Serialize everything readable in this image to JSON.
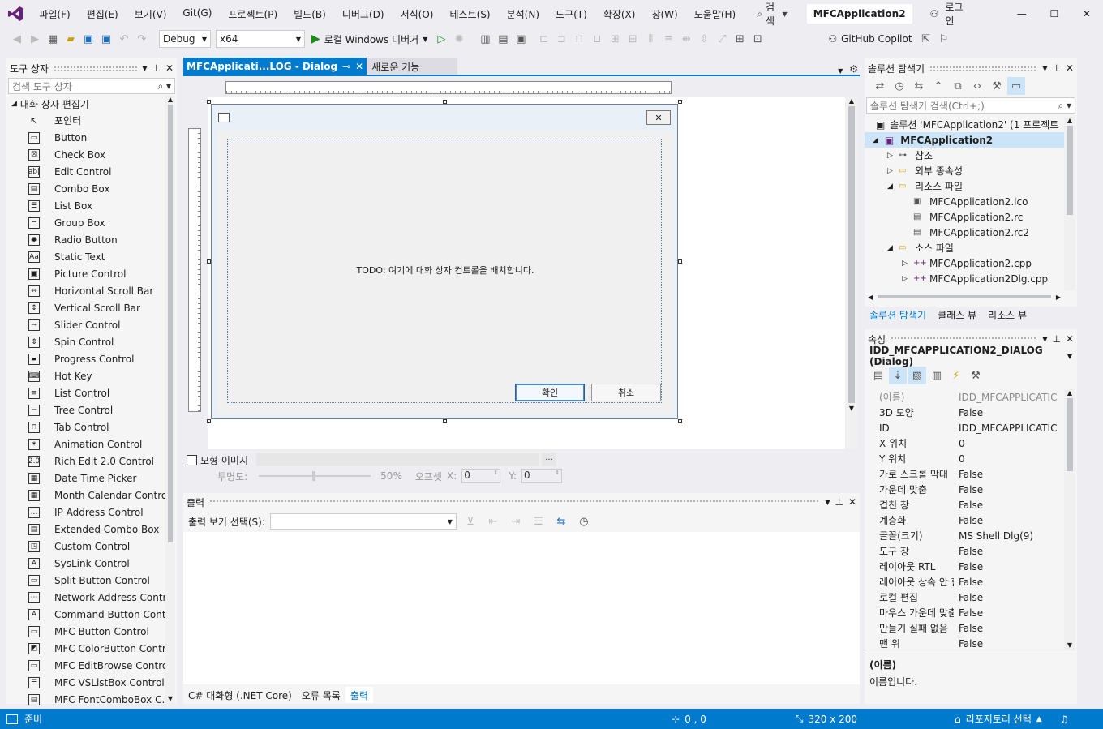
{
  "menu": {
    "items": [
      "파일(F)",
      "편집(E)",
      "보기(V)",
      "Git(G)",
      "프로젝트(P)",
      "빌드(B)",
      "디버그(D)",
      "서식(O)",
      "테스트(S)",
      "분석(N)",
      "도구(T)",
      "확장(X)",
      "창(W)",
      "도움말(H)"
    ],
    "search_label": "검색",
    "solution_name": "MFCApplication2",
    "login_label": "로그인"
  },
  "toolbar": {
    "config": "Debug",
    "platform": "x64",
    "debugger": "로컬 Windows 디버거",
    "copilot": "GitHub Copilot"
  },
  "toolbox": {
    "title": "도구 상자",
    "search_placeholder": "검색 도구 상자",
    "group": "대화 상자 편집기",
    "items": [
      {
        "label": "포인터",
        "icon": "pointer-icon",
        "glyph": "↖"
      },
      {
        "label": "Button",
        "icon": "button-icon",
        "glyph": "▭"
      },
      {
        "label": "Check Box",
        "icon": "checkbox-icon",
        "glyph": "☒"
      },
      {
        "label": "Edit Control",
        "icon": "edit-control-icon",
        "glyph": "ab|"
      },
      {
        "label": "Combo Box",
        "icon": "combo-box-icon",
        "glyph": "▤"
      },
      {
        "label": "List Box",
        "icon": "list-box-icon",
        "glyph": "☰"
      },
      {
        "label": "Group Box",
        "icon": "group-box-icon",
        "glyph": "⌐"
      },
      {
        "label": "Radio Button",
        "icon": "radio-button-icon",
        "glyph": "◉"
      },
      {
        "label": "Static Text",
        "icon": "static-text-icon",
        "glyph": "Aa"
      },
      {
        "label": "Picture Control",
        "icon": "picture-control-icon",
        "glyph": "▣"
      },
      {
        "label": "Horizontal Scroll Bar",
        "icon": "hscroll-icon",
        "glyph": "↔"
      },
      {
        "label": "Vertical Scroll Bar",
        "icon": "vscroll-icon",
        "glyph": "↕"
      },
      {
        "label": "Slider Control",
        "icon": "slider-icon",
        "glyph": "⊸"
      },
      {
        "label": "Spin Control",
        "icon": "spin-icon",
        "glyph": "⇕"
      },
      {
        "label": "Progress Control",
        "icon": "progress-icon",
        "glyph": "▰"
      },
      {
        "label": "Hot Key",
        "icon": "hot-key-icon",
        "glyph": "⌨"
      },
      {
        "label": "List Control",
        "icon": "list-control-icon",
        "glyph": "≡"
      },
      {
        "label": "Tree Control",
        "icon": "tree-control-icon",
        "glyph": "⊢"
      },
      {
        "label": "Tab Control",
        "icon": "tab-control-icon",
        "glyph": "⊓"
      },
      {
        "label": "Animation Control",
        "icon": "animation-icon",
        "glyph": "✶"
      },
      {
        "label": "Rich Edit 2.0 Control",
        "icon": "rich-edit-icon",
        "glyph": "2.0"
      },
      {
        "label": "Date Time Picker",
        "icon": "date-time-icon",
        "glyph": "▦"
      },
      {
        "label": "Month Calendar Control",
        "icon": "calendar-icon",
        "glyph": "▦"
      },
      {
        "label": "IP Address Control",
        "icon": "ip-address-icon",
        "glyph": "…"
      },
      {
        "label": "Extended Combo Box",
        "icon": "ext-combo-icon",
        "glyph": "▤"
      },
      {
        "label": "Custom Control",
        "icon": "custom-control-icon",
        "glyph": "◳"
      },
      {
        "label": "SysLink Control",
        "icon": "syslink-icon",
        "glyph": "A"
      },
      {
        "label": "Split Button Control",
        "icon": "split-button-icon",
        "glyph": "▭"
      },
      {
        "label": "Network Address Control",
        "icon": "network-icon",
        "glyph": "⋯"
      },
      {
        "label": "Command Button Cont...",
        "icon": "command-button-icon",
        "glyph": "A"
      },
      {
        "label": "MFC Button Control",
        "icon": "mfc-button-icon",
        "glyph": "▭"
      },
      {
        "label": "MFC ColorButton Control",
        "icon": "color-button-icon",
        "glyph": "◩"
      },
      {
        "label": "MFC EditBrowse Control",
        "icon": "edit-browse-icon",
        "glyph": "▭"
      },
      {
        "label": "MFC VSListBox Control",
        "icon": "vslistbox-icon",
        "glyph": "☰"
      },
      {
        "label": "MFC FontComboBox C...",
        "icon": "font-combo-icon",
        "glyph": "▤"
      }
    ]
  },
  "editor": {
    "tab_active": "MFCApplicati...LOG - Dialog",
    "tab_inactive": "새로운 기능",
    "dialog_todo": "TODO: 여기에 대화 상자 컨트롤을 배치합니다.",
    "ok_button": "확인",
    "cancel_button": "취소",
    "mock_image_label": "모형 이미지",
    "opacity_label": "투명도:",
    "opacity_value": "50%",
    "offset_label": "오프셋",
    "x_label": "X:",
    "x_value": "0",
    "y_label": "Y:",
    "y_value": "0",
    "browse": "..."
  },
  "output": {
    "title": "출력",
    "select_label": "출력 보기 선택(S):",
    "tabs": [
      "C# 대화형 (.NET Core)",
      "오류 목록",
      "출력"
    ]
  },
  "solution": {
    "title": "솔루션 탐색기",
    "search_placeholder": "솔루션 탐색기 검색(Ctrl+;)",
    "root": "솔루션 'MFCApplication2' (1 프로젝트",
    "project": "MFCApplication2",
    "nodes": [
      {
        "label": "참조",
        "indent": 1,
        "arrow": "▷",
        "icon": "references-icon",
        "glyph": "⊶"
      },
      {
        "label": "외부 종속성",
        "indent": 1,
        "arrow": "▷",
        "icon": "folder-icon",
        "glyph": "▭"
      },
      {
        "label": "리소스 파일",
        "indent": 1,
        "arrow": "◢",
        "icon": "folder-open-icon",
        "glyph": "▭"
      },
      {
        "label": "MFCApplication2.ico",
        "indent": 2,
        "arrow": "",
        "icon": "image-file-icon",
        "glyph": "▣"
      },
      {
        "label": "MFCApplication2.rc",
        "indent": 2,
        "arrow": "",
        "icon": "resource-file-icon",
        "glyph": "▤"
      },
      {
        "label": "MFCApplication2.rc2",
        "indent": 2,
        "arrow": "",
        "icon": "resource-file-icon",
        "glyph": "▤"
      },
      {
        "label": "소스 파일",
        "indent": 1,
        "arrow": "◢",
        "icon": "folder-open-icon",
        "glyph": "▭"
      },
      {
        "label": "MFCApplication2.cpp",
        "indent": 2,
        "arrow": "▷",
        "icon": "cpp-file-icon",
        "glyph": "++"
      },
      {
        "label": "MFCApplication2Dlg.cpp",
        "indent": 2,
        "arrow": "▷",
        "icon": "cpp-file-icon",
        "glyph": "++"
      }
    ],
    "tabs": [
      "솔루션 탐색기",
      "클래스 뷰",
      "리소스 뷰"
    ]
  },
  "properties": {
    "title": "속성",
    "object": "IDD_MFCAPPLICATION2_DIALOG (Dialog)",
    "rows": [
      [
        "(이름)",
        "IDD_MFCAPPLICATIC"
      ],
      [
        "3D 모양",
        "False"
      ],
      [
        "ID",
        "IDD_MFCAPPLICATIC"
      ],
      [
        "X 위치",
        "0"
      ],
      [
        "Y 위치",
        "0"
      ],
      [
        "가로 스크롤 막대",
        "False"
      ],
      [
        "가운데 맞춤",
        "False"
      ],
      [
        "겹친 창",
        "False"
      ],
      [
        "계층화",
        "False"
      ],
      [
        "글꼴(크기)",
        "MS Shell Dlg(9)"
      ],
      [
        "도구 창",
        "False"
      ],
      [
        "레이아웃 RTL",
        "False"
      ],
      [
        "레이아웃 상속 안 함",
        "False"
      ],
      [
        "로컬 편집",
        "False"
      ],
      [
        "마우스 가운데 맞춤",
        "False"
      ],
      [
        "만들기 실패 없음",
        "False"
      ],
      [
        "맨 위",
        "False"
      ]
    ],
    "desc_title": "(이름)",
    "desc_text": "이름입니다."
  },
  "status": {
    "ready": "준비",
    "position": "0 , 0",
    "size": "320 x 200",
    "repo": "리포지토리 선택"
  },
  "colors": {
    "accent": "#007acc",
    "vs_purple": "#68217a"
  }
}
